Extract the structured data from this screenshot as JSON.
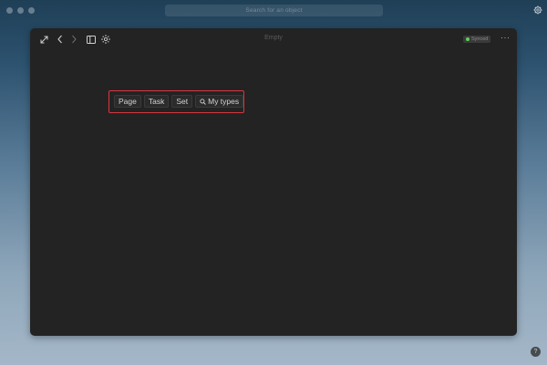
{
  "app": {
    "search_placeholder": "Search for an object"
  },
  "toolbar": {
    "title": "Empty",
    "sync_status": "Synced",
    "sync_color": "#5fcf5f",
    "more_label": "···"
  },
  "types": {
    "items": [
      {
        "label": "Page"
      },
      {
        "label": "Task"
      },
      {
        "label": "Set"
      }
    ],
    "search_label": "My types"
  },
  "footer": {
    "help_label": "?"
  },
  "icons": {
    "window_controls": [
      "close-dot",
      "minimize-dot",
      "maximize-dot"
    ],
    "settings": "gear-icon",
    "expand": "expand-icon",
    "back": "chevron-left-icon",
    "forward": "chevron-right-icon",
    "sidebar": "sidebar-icon",
    "graph": "graph-icon",
    "search": "search-icon"
  },
  "colors": {
    "highlight": "#d9373f",
    "window_bg": "#232323"
  }
}
